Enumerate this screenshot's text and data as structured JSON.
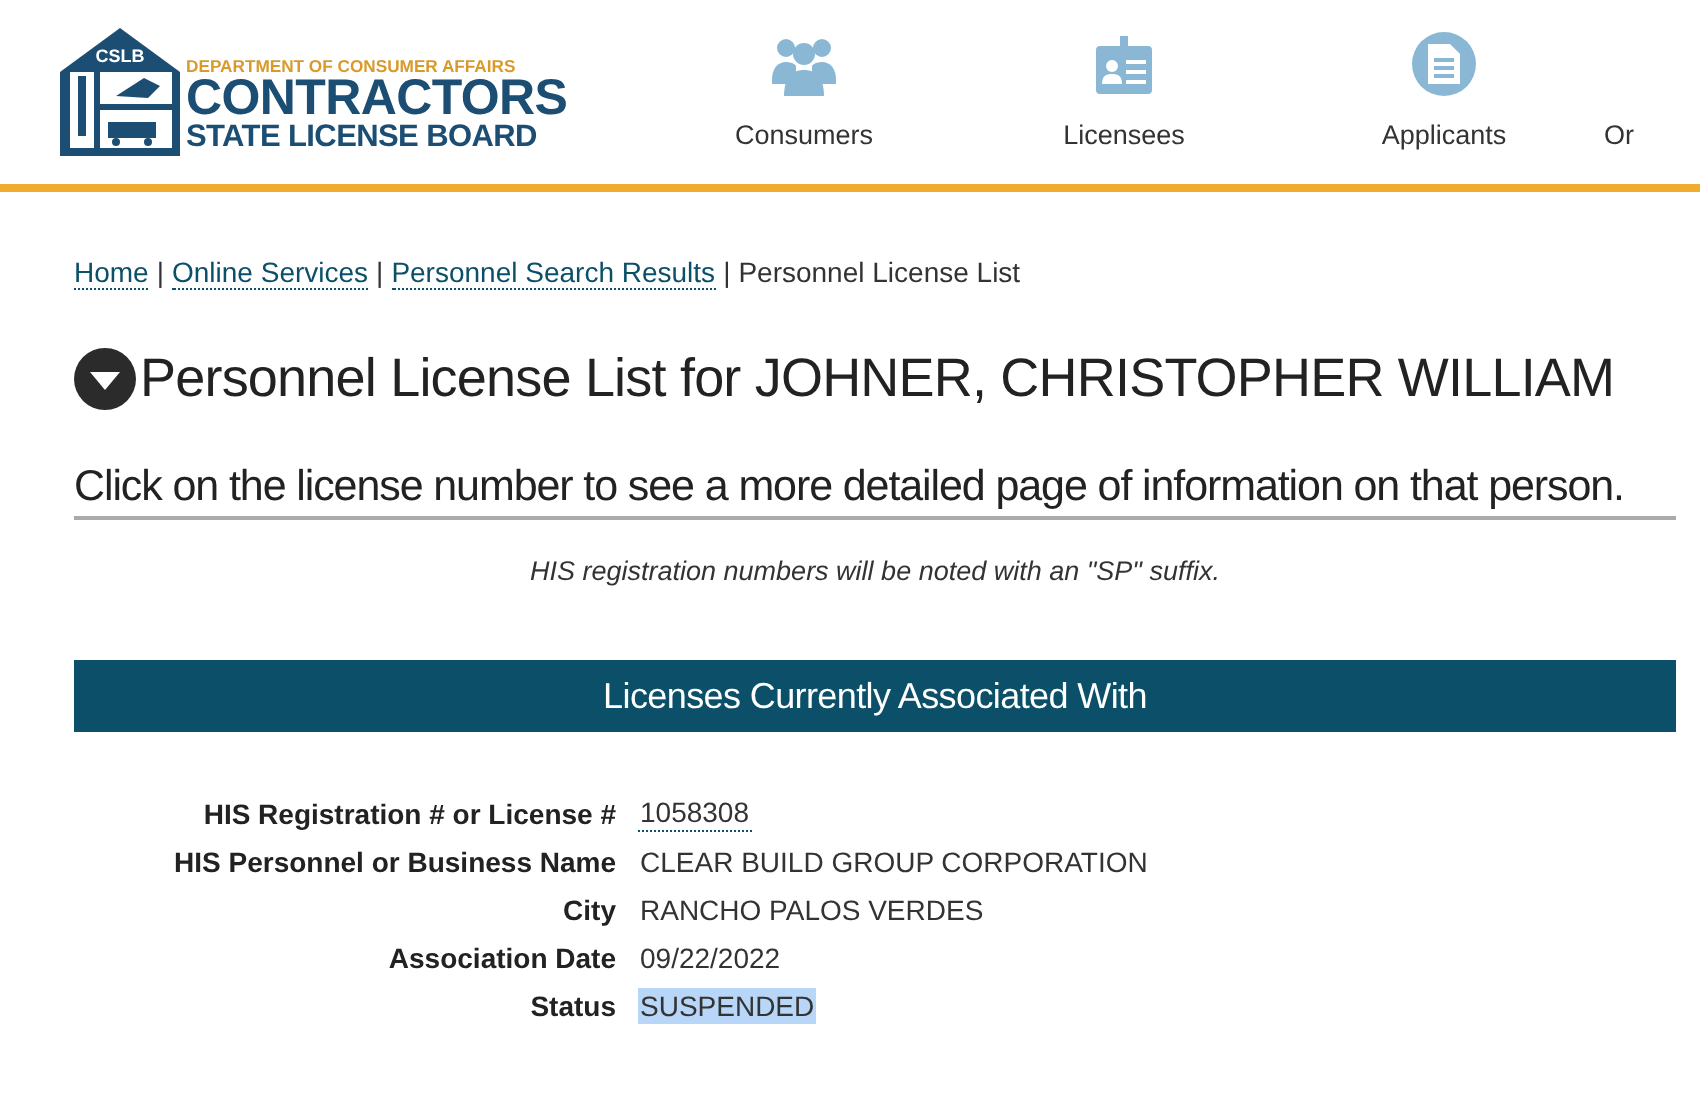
{
  "header": {
    "logo": {
      "badge": "CSLB",
      "department": "DEPARTMENT OF CONSUMER AFFAIRS",
      "name": "CONTRACTORS",
      "subname": "STATE LICENSE BOARD"
    },
    "nav": [
      {
        "label": "Consumers",
        "kind": "people"
      },
      {
        "label": "Licensees",
        "kind": "badge"
      },
      {
        "label": "Applicants",
        "kind": "document"
      },
      {
        "label": "Or",
        "kind": "none"
      }
    ]
  },
  "breadcrumbs": [
    {
      "label": "Home",
      "kind": "link"
    },
    {
      "label": "Online Services",
      "kind": "link"
    },
    {
      "label": "Personnel Search Results",
      "kind": "link"
    },
    {
      "label": "Personnel License List",
      "kind": "current"
    }
  ],
  "breadcrumb_separator": "|",
  "heading": "Personnel License List for JOHNER, CHRISTOPHER WILLIAM",
  "instruction": "Click on the license number to see a more detailed page of information on that person.",
  "note": "HIS registration numbers will be noted with an \"SP\" suffix.",
  "section_title": "Licenses Currently Associated With",
  "details": [
    {
      "label": "HIS Registration # or License #",
      "value": "1058308",
      "kind": "link",
      "highlighted": false
    },
    {
      "label": "HIS Personnel or Business Name",
      "value": "CLEAR BUILD GROUP CORPORATION",
      "kind": "text",
      "highlighted": false
    },
    {
      "label": "City",
      "value": "RANCHO PALOS VERDES",
      "kind": "text",
      "highlighted": false
    },
    {
      "label": "Association Date",
      "value": "09/22/2022",
      "kind": "text",
      "highlighted": false
    },
    {
      "label": "Status",
      "value": "SUSPENDED",
      "kind": "text",
      "highlighted": true
    }
  ]
}
